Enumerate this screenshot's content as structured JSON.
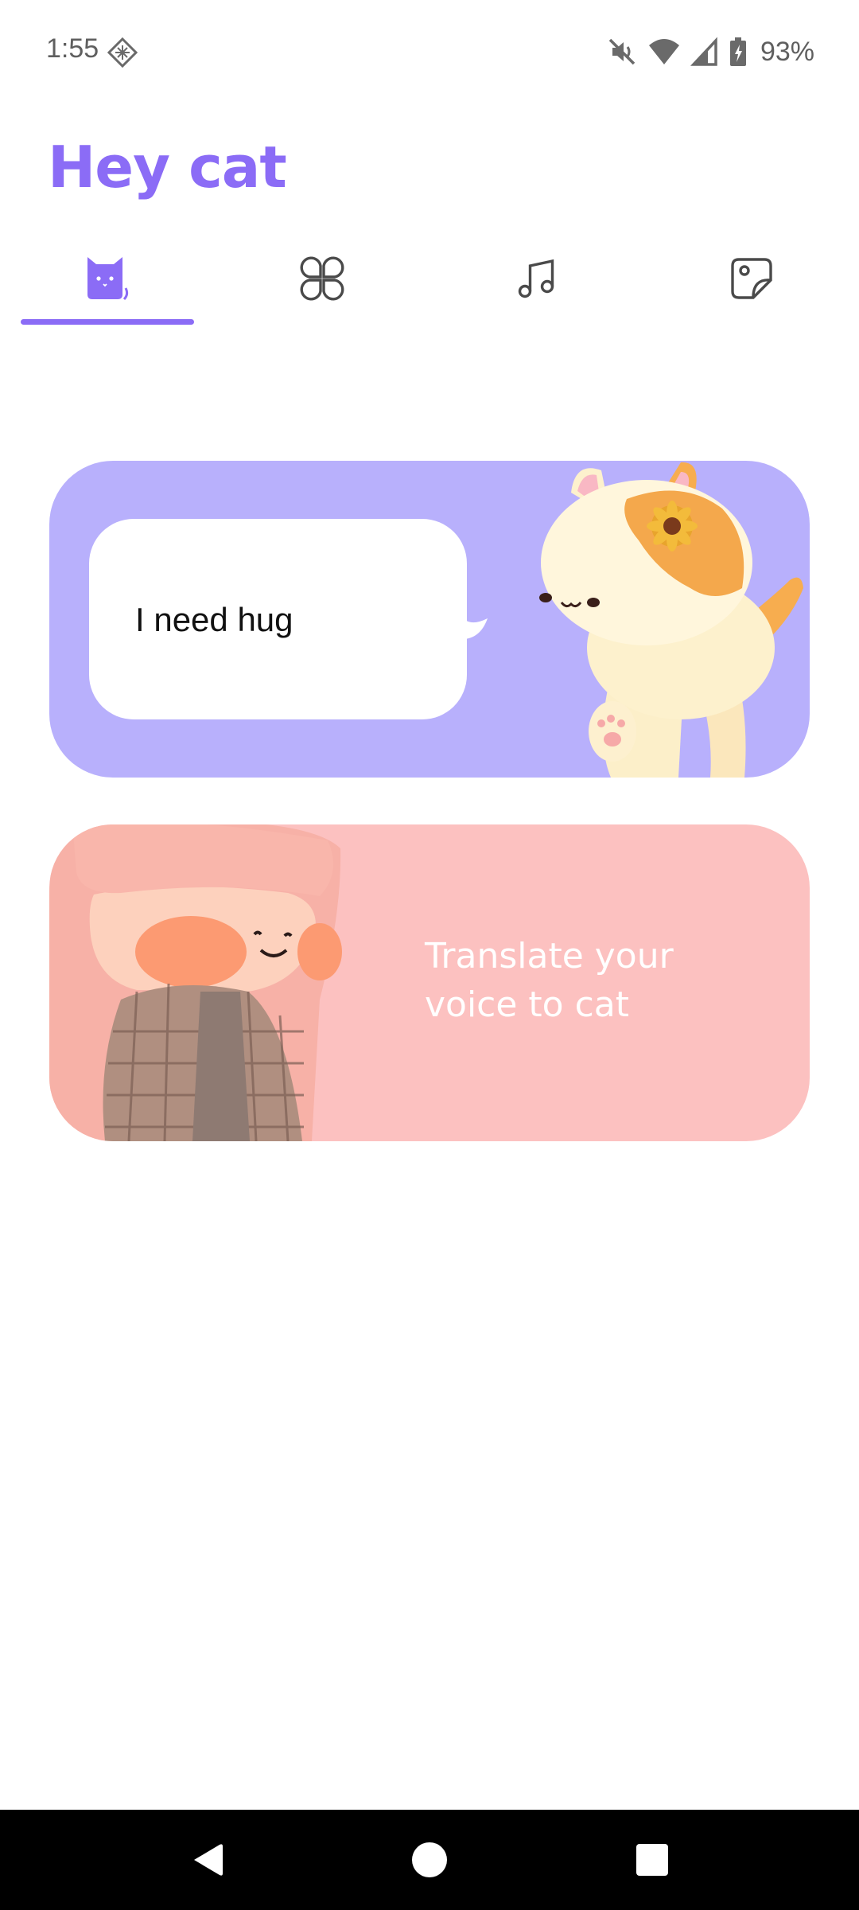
{
  "status_bar": {
    "time": "1:55",
    "battery_percent": "93%",
    "icons": [
      "app-notification-icon",
      "mute-icon",
      "wifi-icon",
      "signal-icon",
      "battery-charging-icon"
    ]
  },
  "header": {
    "title": "Hey cat"
  },
  "tabs": [
    {
      "name": "cat",
      "icon": "cat-icon",
      "selected": true
    },
    {
      "name": "clover",
      "icon": "clover-icon",
      "selected": false
    },
    {
      "name": "music",
      "icon": "music-note-icon",
      "selected": false
    },
    {
      "name": "sticker",
      "icon": "sticker-icon",
      "selected": false
    }
  ],
  "cards": {
    "hug": {
      "bubble_text": "I need hug"
    },
    "translate": {
      "text_line1": "Translate your",
      "text_line2": "voice to cat"
    }
  },
  "nav_bar": {
    "buttons": [
      "back-icon",
      "home-icon",
      "recents-icon"
    ]
  },
  "colors": {
    "accent": "#8b6cf6",
    "hug_card": "#b8b0fc",
    "translate_card": "#fcc1c0",
    "nav_bar": "#000000"
  }
}
